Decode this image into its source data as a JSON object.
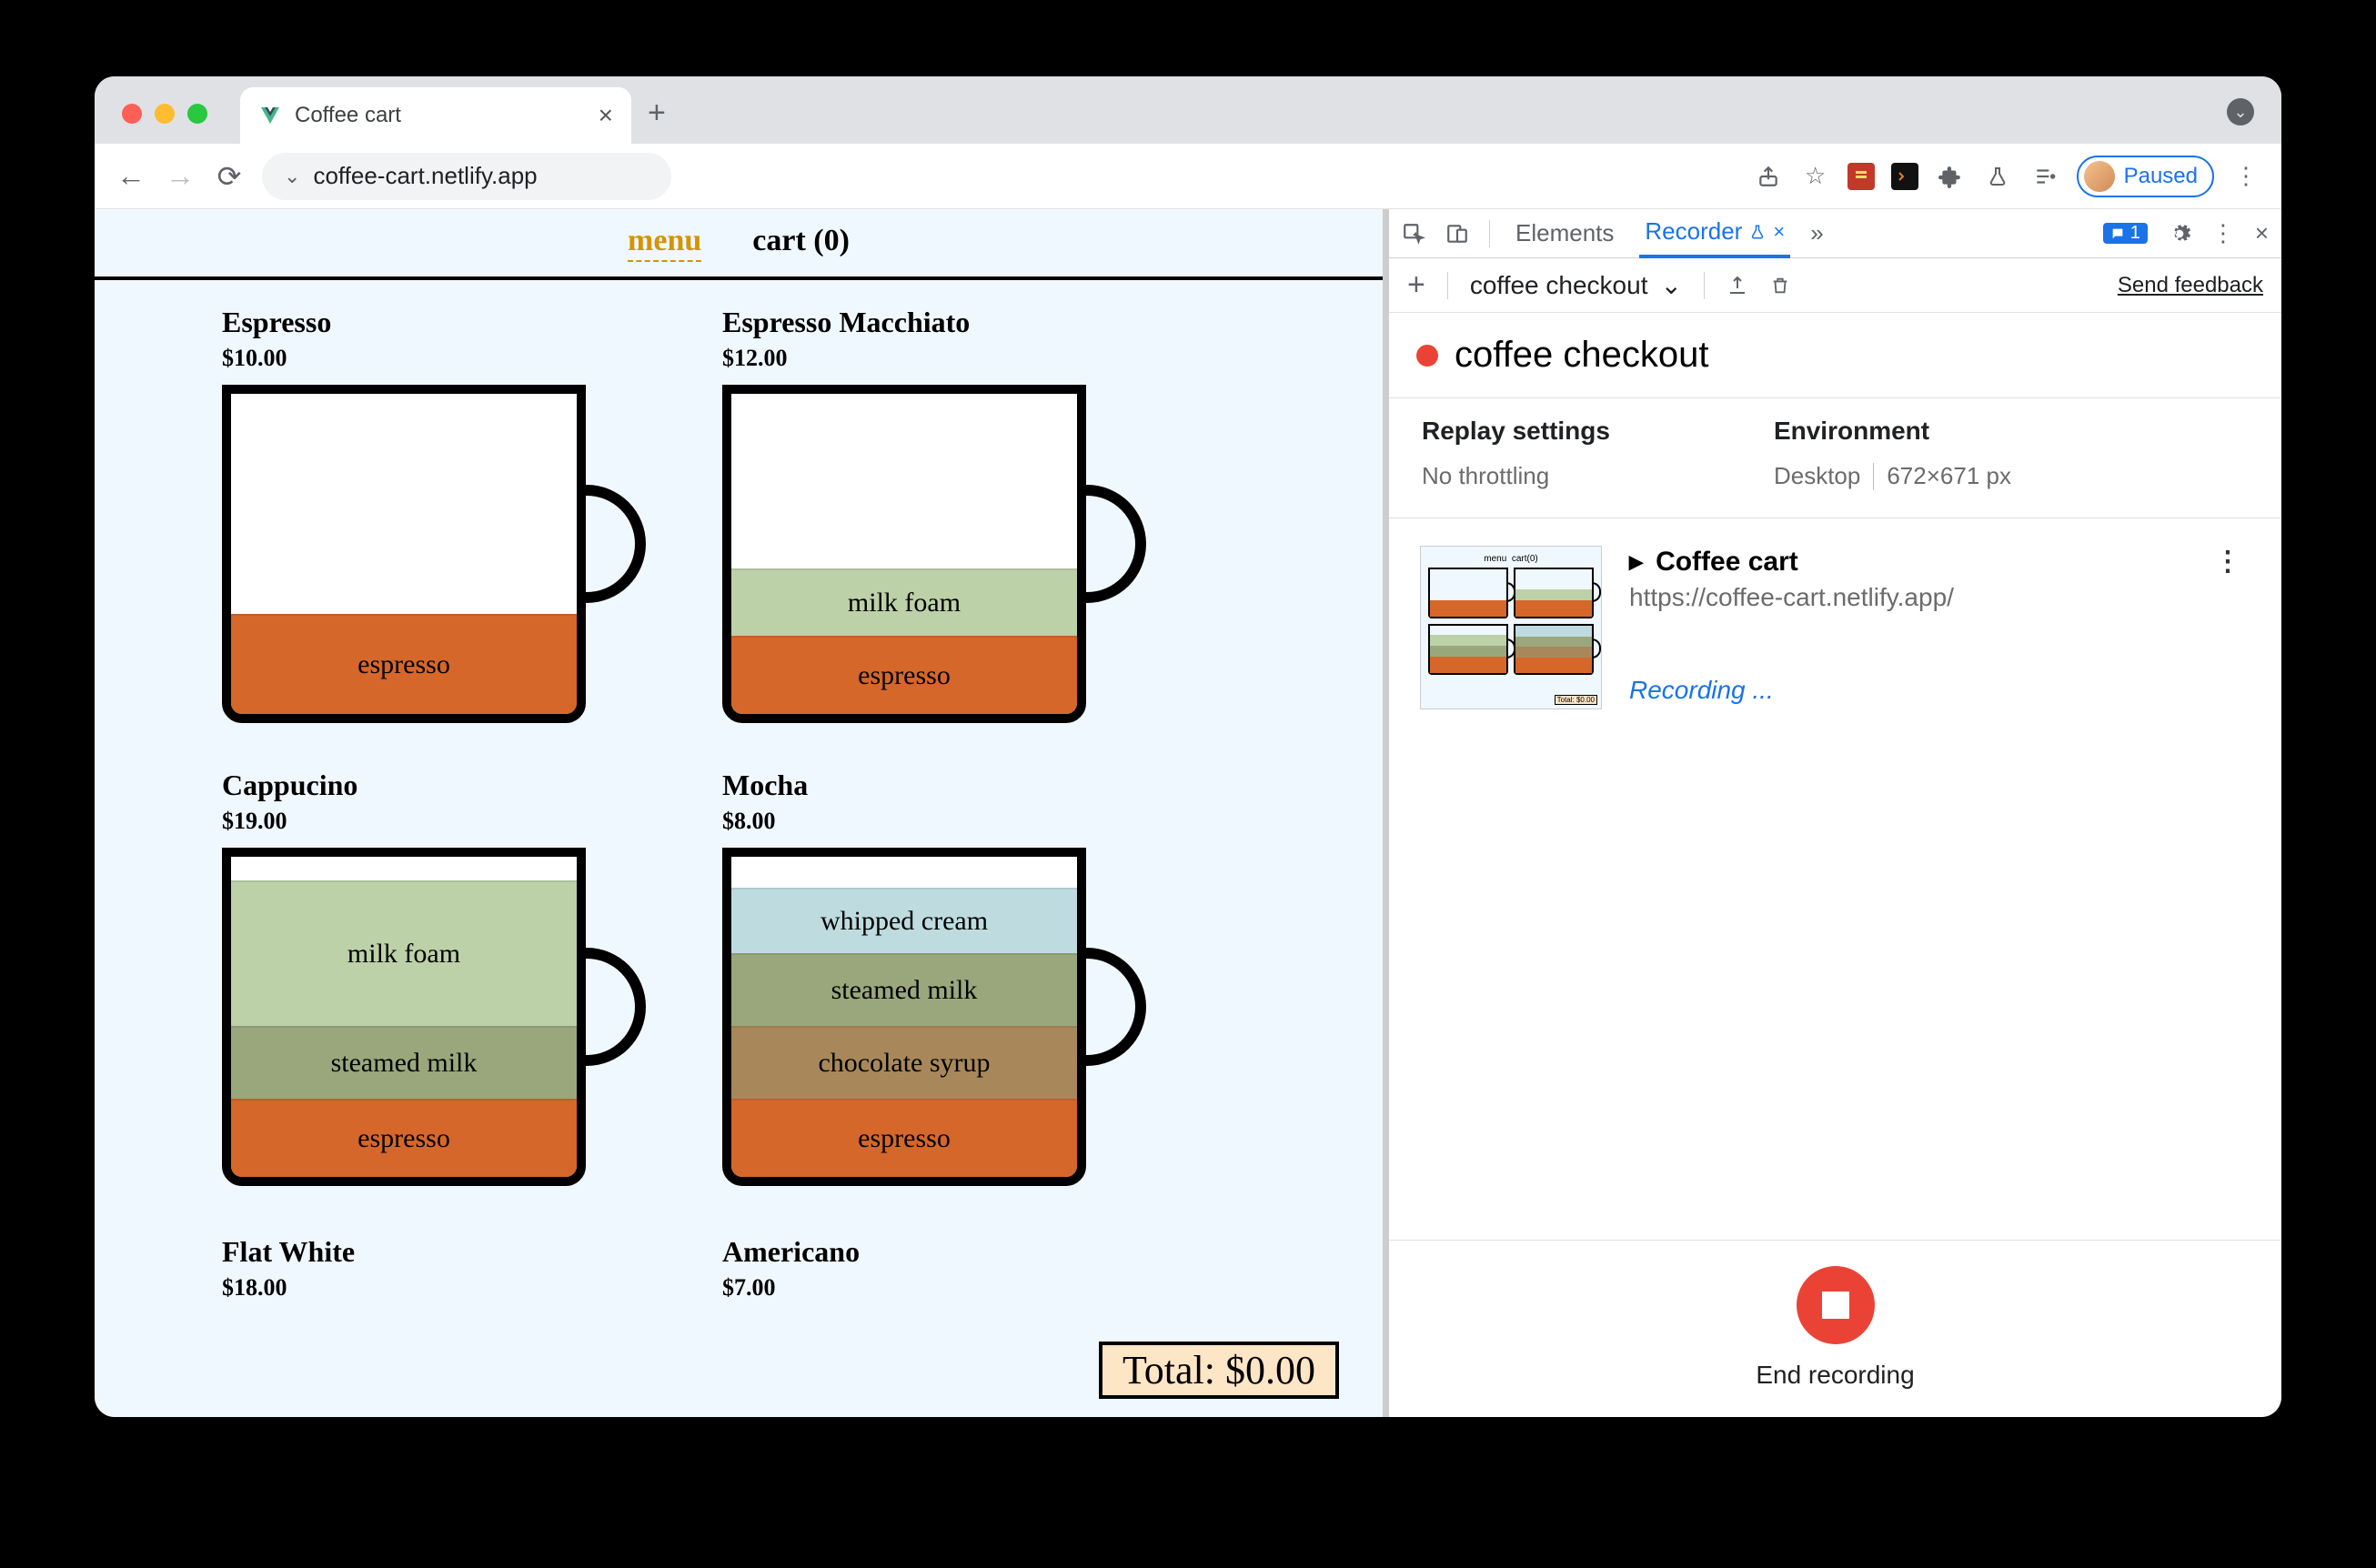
{
  "browser": {
    "tab_title": "Coffee cart",
    "url": "coffee-cart.netlify.app",
    "profile_status": "Paused"
  },
  "app": {
    "nav": {
      "menu": "menu",
      "cart": "cart (0)"
    },
    "items": [
      {
        "name": "Espresso",
        "price": "$10.00",
        "layers": [
          {
            "label": "espresso",
            "cls": "c-espresso"
          }
        ]
      },
      {
        "name": "Espresso Macchiato",
        "price": "$12.00",
        "layers": [
          {
            "label": "milk foam",
            "cls": "c-milkfoam"
          },
          {
            "label": "espresso",
            "cls": "c-espresso-half"
          }
        ]
      },
      {
        "name": "Cappucino",
        "price": "$19.00",
        "layers": [
          {
            "label": "milk foam",
            "cls": "c-milkfoam-big"
          },
          {
            "label": "steamed milk",
            "cls": "c-steamed"
          },
          {
            "label": "espresso",
            "cls": "c-espresso-half"
          }
        ]
      },
      {
        "name": "Mocha",
        "price": "$8.00",
        "layers": [
          {
            "label": "whipped cream",
            "cls": "c-whip"
          },
          {
            "label": "steamed milk",
            "cls": "c-steamed"
          },
          {
            "label": "chocolate syrup",
            "cls": "c-chocolate"
          },
          {
            "label": "espresso",
            "cls": "c-espresso-half"
          }
        ]
      },
      {
        "name": "Flat White",
        "price": "$18.00"
      },
      {
        "name": "Americano",
        "price": "$7.00"
      }
    ],
    "total": "Total: $0.00"
  },
  "devtools": {
    "tabs": {
      "elements": "Elements",
      "recorder": "Recorder"
    },
    "msg_count": "1",
    "toolbar": {
      "flow_name": "coffee checkout",
      "send_feedback": "Send feedback"
    },
    "title": "coffee checkout",
    "settings": {
      "replay_heading": "Replay settings",
      "replay_value": "No throttling",
      "env_heading": "Environment",
      "env_device": "Desktop",
      "env_size": "672×671 px"
    },
    "step": {
      "title": "Coffee cart",
      "url": "https://coffee-cart.netlify.app/",
      "status": "Recording ..."
    },
    "footer": {
      "end": "End recording"
    }
  }
}
